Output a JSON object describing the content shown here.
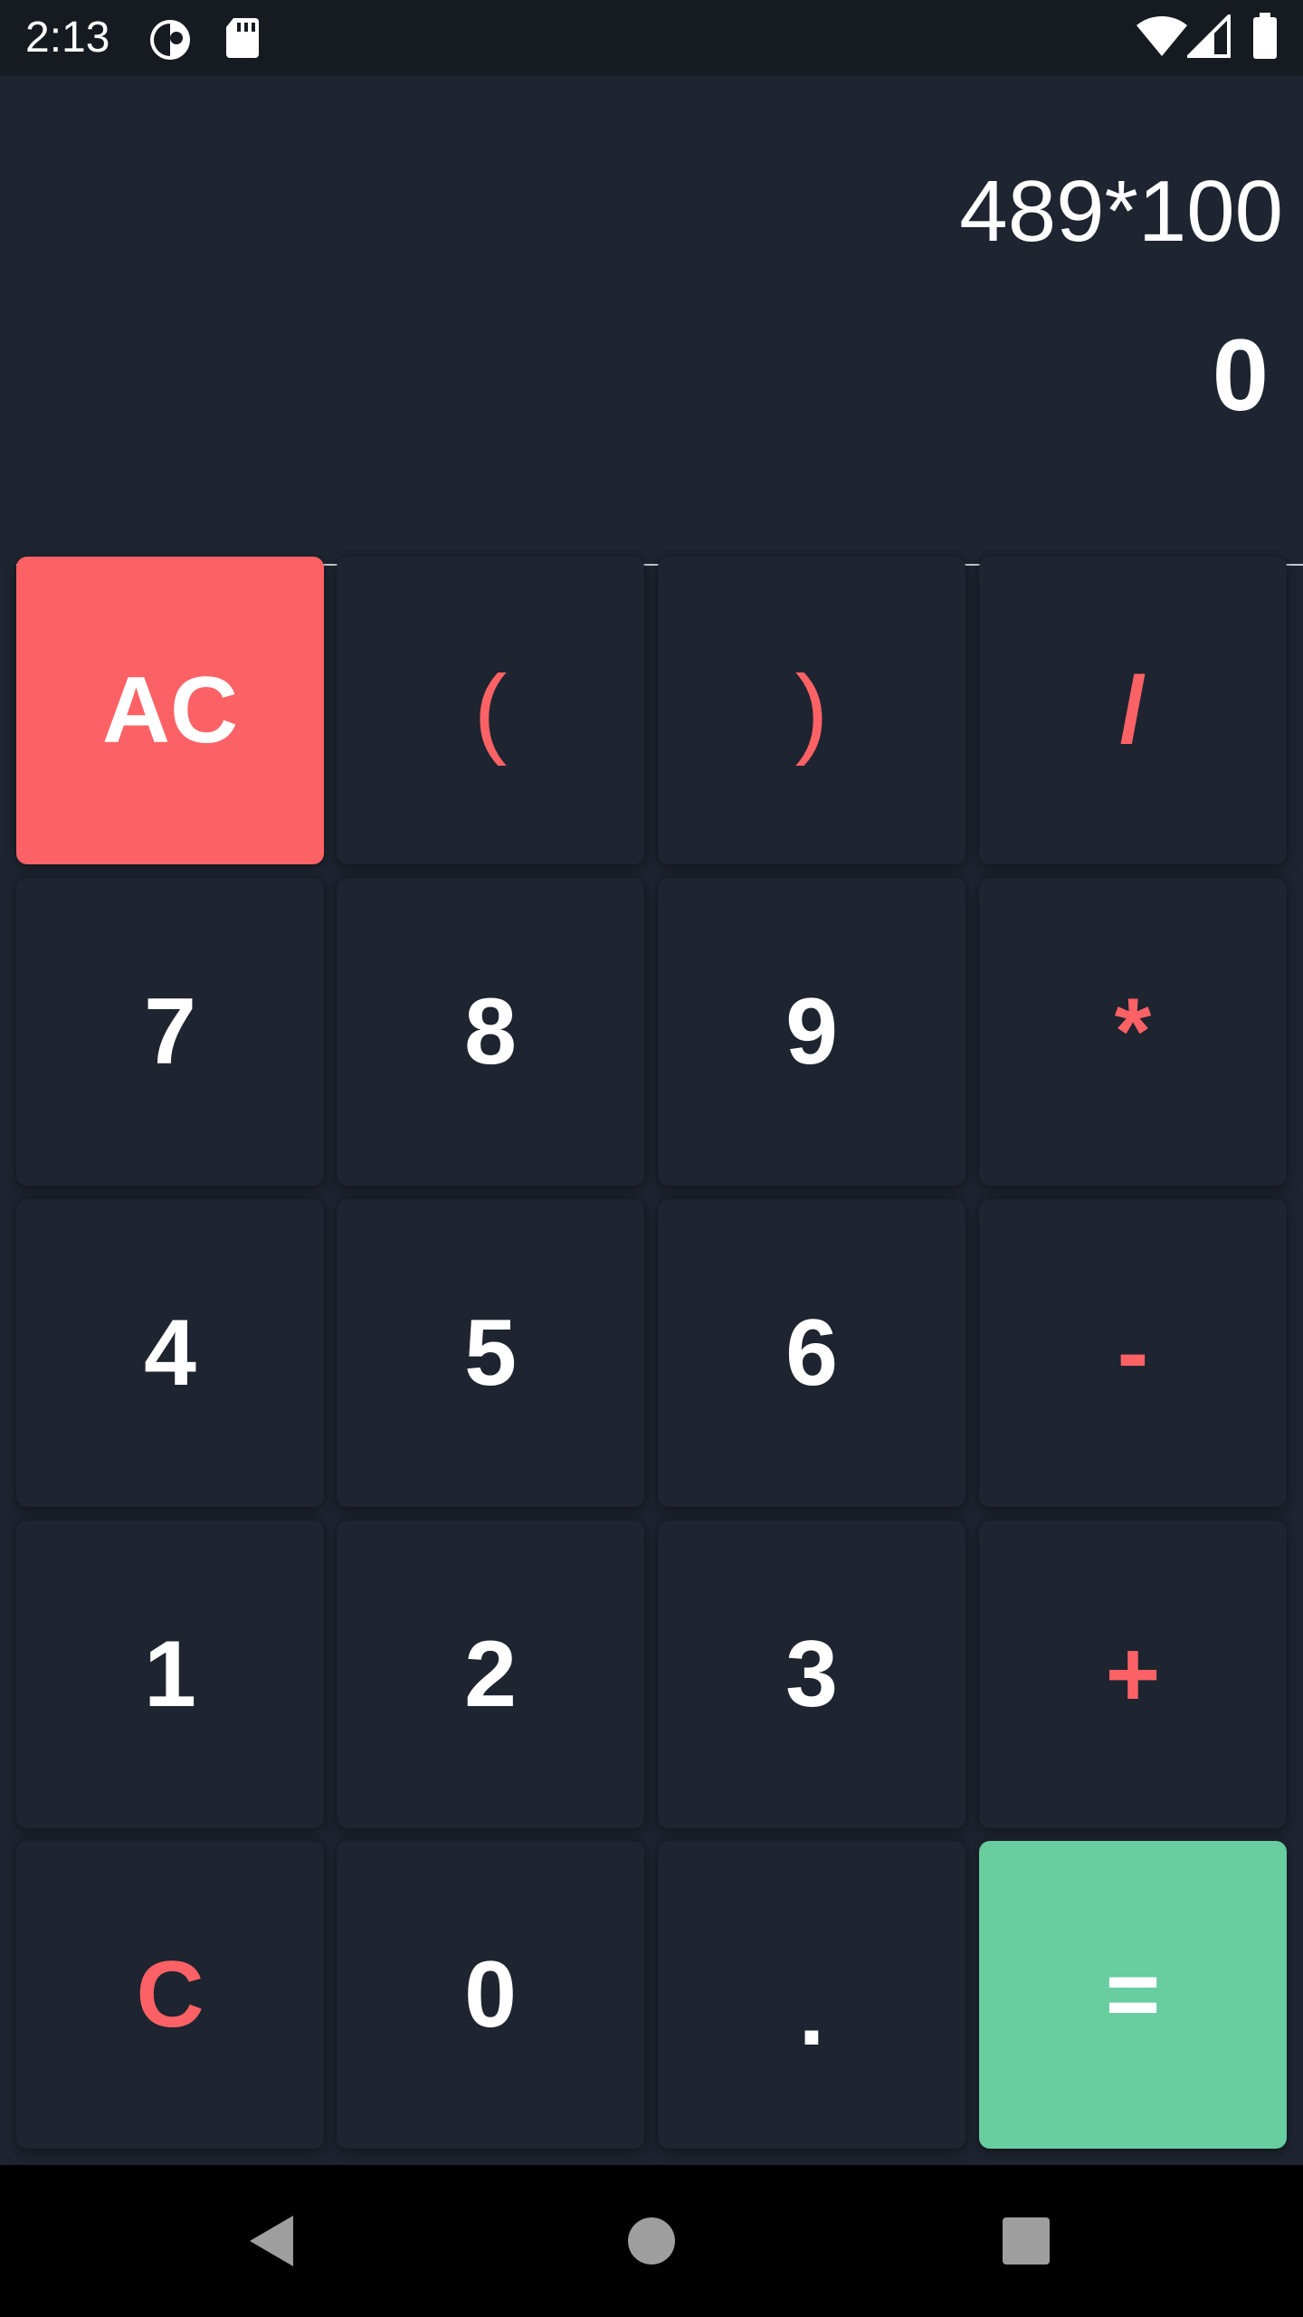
{
  "status_bar": {
    "time": "2:13",
    "icons": [
      "data-saver-icon",
      "sd-card-icon",
      "wifi-icon",
      "cell-signal-icon",
      "battery-icon"
    ]
  },
  "display": {
    "expression": "489*100",
    "result": "0"
  },
  "keypad": {
    "rows": [
      [
        {
          "label": "AC",
          "name": "all-clear-button",
          "kind": "ac"
        },
        {
          "label": "(",
          "name": "open-paren-button",
          "kind": "op"
        },
        {
          "label": ")",
          "name": "close-paren-button",
          "kind": "op"
        },
        {
          "label": "/",
          "name": "divide-button",
          "kind": "op"
        }
      ],
      [
        {
          "label": "7",
          "name": "digit-7-button",
          "kind": "num"
        },
        {
          "label": "8",
          "name": "digit-8-button",
          "kind": "num"
        },
        {
          "label": "9",
          "name": "digit-9-button",
          "kind": "num"
        },
        {
          "label": "*",
          "name": "multiply-button",
          "kind": "op"
        }
      ],
      [
        {
          "label": "4",
          "name": "digit-4-button",
          "kind": "num"
        },
        {
          "label": "5",
          "name": "digit-5-button",
          "kind": "num"
        },
        {
          "label": "6",
          "name": "digit-6-button",
          "kind": "num"
        },
        {
          "label": "-",
          "name": "subtract-button",
          "kind": "op"
        }
      ],
      [
        {
          "label": "1",
          "name": "digit-1-button",
          "kind": "num"
        },
        {
          "label": "2",
          "name": "digit-2-button",
          "kind": "num"
        },
        {
          "label": "3",
          "name": "digit-3-button",
          "kind": "num"
        },
        {
          "label": "+",
          "name": "add-button",
          "kind": "op"
        }
      ],
      [
        {
          "label": "C",
          "name": "clear-button",
          "kind": "op"
        },
        {
          "label": "0",
          "name": "digit-0-button",
          "kind": "num"
        },
        {
          "label": ".",
          "name": "decimal-button",
          "kind": "num"
        },
        {
          "label": "=",
          "name": "equals-button",
          "kind": "eq"
        }
      ]
    ]
  },
  "navigation_bar": {
    "icons": [
      "back-icon",
      "home-icon",
      "recents-icon"
    ]
  },
  "colors": {
    "background": "#1e2430",
    "accent_red": "#fc6265",
    "accent_green": "#68cd9f",
    "text": "#ffffff"
  }
}
